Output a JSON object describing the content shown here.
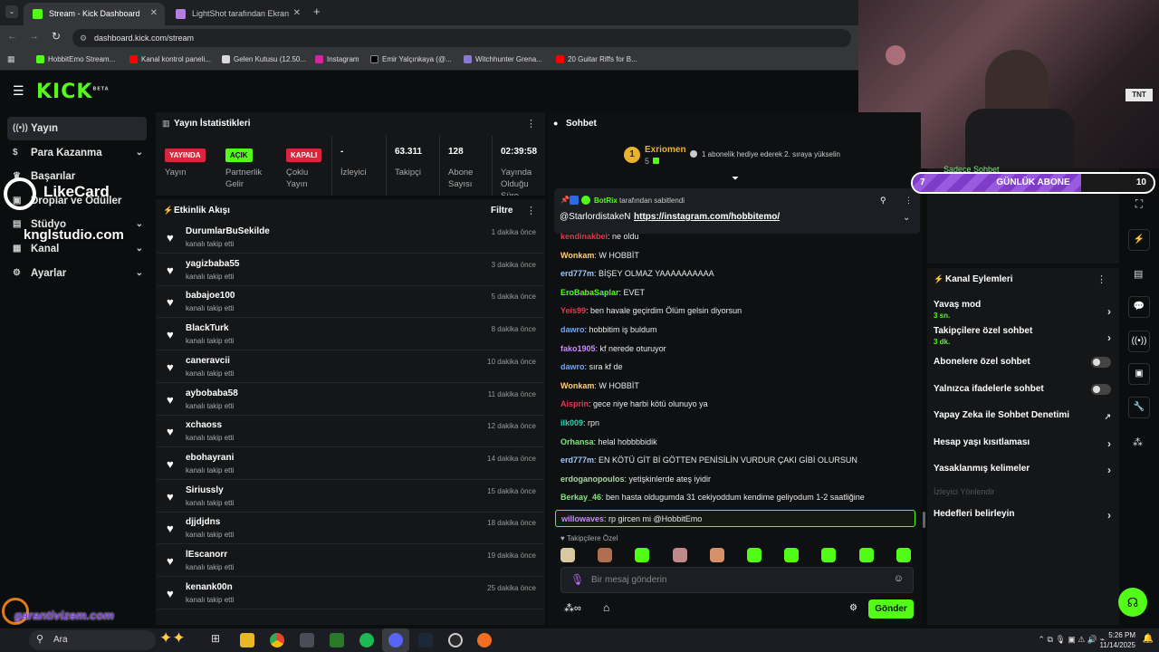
{
  "browser": {
    "tabs": [
      {
        "label": "Stream - Kick Dashboard",
        "active": true
      },
      {
        "label": "LightShot tarafından Ekran Gör..."
      }
    ],
    "url": "dashboard.kick.com/stream",
    "bookmarks": [
      "HobbitEmo Stream...",
      "Kanal kontrol paneli...",
      "Gelen Kutusu (12.50...",
      "Instagram",
      "Emir Yalçınkaya (@...",
      "Witchhunter Grena...",
      "20 Guitar Riffs for B..."
    ]
  },
  "brand": {
    "logo": "KICK",
    "beta": "BETA",
    "accent": "#53fc18"
  },
  "sidebar": {
    "items": [
      {
        "label": "Yayın"
      },
      {
        "label": "Para Kazanma"
      },
      {
        "label": "Başarılar"
      },
      {
        "label": "Droplar ve Ödüller"
      },
      {
        "label": "Stüdyo"
      },
      {
        "label": "Kanal"
      },
      {
        "label": "Ayarlar"
      }
    ]
  },
  "watermarks": {
    "likecard": "LikeCard",
    "kngl": "knglstudio.com",
    "garanti": "garantivizem.com"
  },
  "stats": {
    "title": "Yayın İstatistikleri",
    "yayin": {
      "badge": "YAYINDA",
      "label": "Yayın"
    },
    "partner": {
      "badge": "AÇIK",
      "label": "Partnerlik Gelir"
    },
    "multi": {
      "badge": "KAPALI",
      "label": "Çoklu Yayın"
    },
    "viewers": {
      "value": "-",
      "label": "İzleyici"
    },
    "followers": {
      "value": "63.311",
      "label": "Takipçi"
    },
    "subs": {
      "value": "128",
      "label": "Abone Sayısı"
    },
    "uptime": {
      "value": "02:39:58",
      "label": "Yayında Olduğu Süre"
    }
  },
  "activity": {
    "title": "Etkinlik Akışı",
    "filter": "Filtre",
    "items": [
      {
        "name": "DurumlarBuSekilde",
        "sub": "kanalı takip etti",
        "time": "1 dakika önce"
      },
      {
        "name": "yagizbaba55",
        "sub": "kanalı takip etti",
        "time": "3 dakika önce"
      },
      {
        "name": "babajoe100",
        "sub": "kanalı takip etti",
        "time": "5 dakika önce"
      },
      {
        "name": "BlackTurk",
        "sub": "kanalı takip etti",
        "time": "8 dakika önce"
      },
      {
        "name": "caneravcii",
        "sub": "kanalı takip etti",
        "time": "10 dakika önce"
      },
      {
        "name": "aybobaba58",
        "sub": "kanalı takip etti",
        "time": "11 dakika önce"
      },
      {
        "name": "xchaoss",
        "sub": "kanalı takip etti",
        "time": "12 dakika önce"
      },
      {
        "name": "ebohayrani",
        "sub": "kanalı takip etti",
        "time": "14 dakika önce"
      },
      {
        "name": "Siriussly",
        "sub": "kanalı takip etti",
        "time": "15 dakika önce"
      },
      {
        "name": "djjdjdns",
        "sub": "kanalı takip etti",
        "time": "18 dakika önce"
      },
      {
        "name": "lEscanorr",
        "sub": "kanalı takip etti",
        "time": "19 dakika önce"
      },
      {
        "name": "kenank00n",
        "sub": "kanalı takip etti",
        "time": "25 dakika önce"
      }
    ]
  },
  "chat": {
    "title": "Sohbet",
    "leader": {
      "rank": "1",
      "name": "Exriomen",
      "count": "5",
      "note": "1 abonelik hediye ederek 2. sıraya yükselin"
    },
    "pinned": {
      "by": "BotRix",
      "by_suffix": "tarafından sabitlendi",
      "user": "@StarlordistakeN",
      "link": "https://instagram.com/hobbitemo/"
    },
    "messages": [
      {
        "user": "kendinakbei",
        "text": ": ne oldu",
        "color": "#e53950"
      },
      {
        "user": "Wonkam",
        "text": ": W HOBBİT",
        "color": "#ffd27a"
      },
      {
        "user": "erd777m",
        "text": ": BİŞEY OLMAZ YAAAAAAAAAA",
        "color": "#9ec7ff"
      },
      {
        "user": "EroBabaSaplar",
        "text": ": EVET",
        "color": "#53fc18"
      },
      {
        "user": "Yeis99",
        "text": ": ben havale geçirdim Ölüm gelsin diyorsun",
        "color": "#e53950"
      },
      {
        "user": "dawro",
        "text": ": hobbitim iş buldum",
        "color": "#6aa6ff"
      },
      {
        "user": "fako1905",
        "text": ": kf nerede oturuyor",
        "color": "#c78bff"
      },
      {
        "user": "dawro",
        "text": ": sıra kf de",
        "color": "#6aa6ff"
      },
      {
        "user": "Wonkam",
        "text": ": W HOBBİT",
        "color": "#ffd27a"
      },
      {
        "user": "Aisprin",
        "text": ": gece niye harbi kötü olunuyo ya",
        "color": "#e53950"
      },
      {
        "user": "ilk009",
        "text": ": rpn",
        "color": "#35d2b0"
      },
      {
        "user": "Orhansa",
        "text": ": helal hobbbbidik",
        "color": "#7ee87e"
      },
      {
        "user": "erd777m",
        "text": ": EN KÖTÜ GİT Bİ GÖTTEN PENİSİLİN VURDUR ÇAKI GİBİ OLURSUN",
        "color": "#9ec7ff"
      },
      {
        "user": "erdoganopoulos",
        "text": ": yetişkinlerde ateş iyidir",
        "color": "#a8d8a0"
      },
      {
        "user": "Berkay_46",
        "text": ": ben hasta oldugumda 31 cekiyoddum kendime geliyodum 1-2 saatliğine",
        "color": "#7ee87e"
      }
    ],
    "highlight": {
      "user": "willowaves",
      "text": ": rp gircen mi @HobbitEmo",
      "color": "#c78bff"
    },
    "followers_only": "Takipçilere Özel",
    "input_placeholder": "Bir mesaj gönderin",
    "send": "Gönder"
  },
  "overlay": {
    "level": "7",
    "label": "GÜNLÜK ABONE",
    "target": "10",
    "fill_fraction": 0.7,
    "behind_text": "Sadece Sohbet"
  },
  "channel_actions": {
    "title": "Kanal Eylemleri",
    "items": [
      {
        "label": "Yavaş mod",
        "sub": "3 sn.",
        "kind": "chevron"
      },
      {
        "label": "Takipçilere özel sohbet",
        "sub": "3 dk.",
        "kind": "chevron"
      },
      {
        "label": "Abonelere özel sohbet",
        "kind": "toggle"
      },
      {
        "label": "Yalnızca ifadelerle sohbet",
        "kind": "toggle"
      },
      {
        "label": "Yapay Zeka ile Sohbet Denetimi",
        "kind": "external"
      },
      {
        "label": "Hesap yaşı kısıtlaması",
        "kind": "chevron"
      },
      {
        "label": "Yasaklanmış kelimeler",
        "kind": "chevron"
      },
      {
        "label": "İzleyici Yönlendir",
        "kind": "disabled"
      },
      {
        "label": "Hedefleri belirleyin",
        "kind": "chevron"
      }
    ]
  },
  "taskbar": {
    "search": "Ara",
    "time": "5:26 PM",
    "date": "11/14/2025"
  }
}
